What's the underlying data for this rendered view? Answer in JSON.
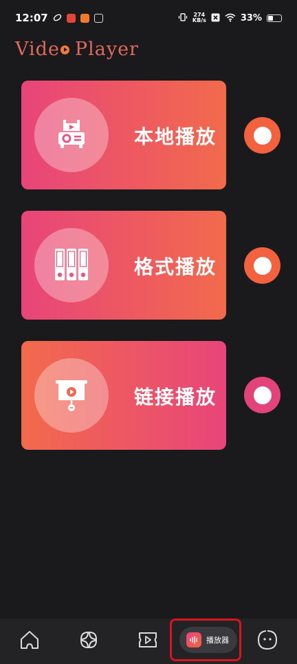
{
  "status_bar": {
    "time": "12:07",
    "net_speed_value": "274",
    "net_speed_unit": "KB/s",
    "battery_percent": "33%",
    "icons": [
      "leaf-icon",
      "red-app-icon",
      "orange-app-icon",
      "white-app-icon",
      "vibrate-icon",
      "network-speed-icon",
      "close-box-icon",
      "wifi-icon",
      "battery-icon"
    ]
  },
  "header": {
    "title_part1": "Vide",
    "title_part2": "Player"
  },
  "cards": [
    {
      "label": "本地播放",
      "icon": "projector-icon"
    },
    {
      "label": "格式播放",
      "icon": "video-format-files-icon"
    },
    {
      "label": "链接播放",
      "icon": "link-screen-icon"
    }
  ],
  "bottom_nav": {
    "items": [
      {
        "icon": "home-icon"
      },
      {
        "icon": "apps-grid-icon"
      },
      {
        "icon": "video-play-icon"
      },
      {
        "icon": "audio-wave-icon",
        "label": "播放器",
        "active": true
      },
      {
        "icon": "smiley-face-icon"
      }
    ]
  },
  "colors": {
    "background": "#1a1a1c",
    "title": "#e0685e",
    "accent_pink": "#e8457a",
    "accent_orange": "#f26a4c",
    "highlight": "#d8141e"
  }
}
